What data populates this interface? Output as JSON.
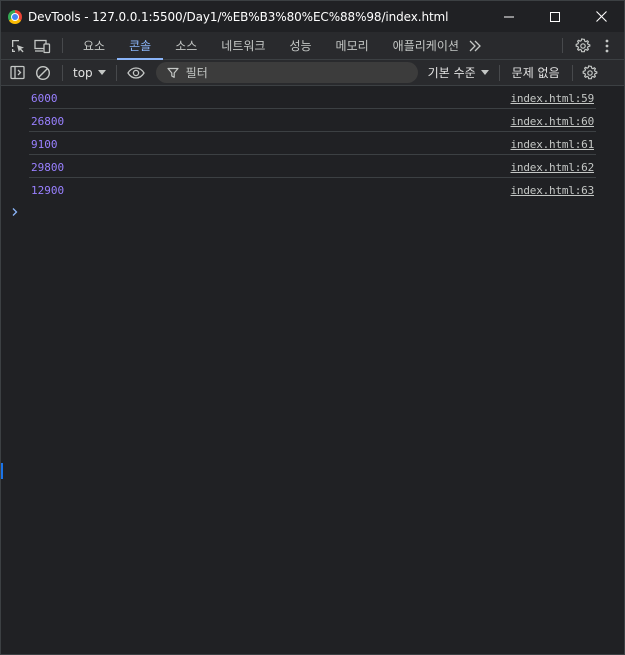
{
  "window": {
    "title": "DevTools - 127.0.0.1:5500/Day1/%EB%B3%80%EC%88%98/index.html"
  },
  "tabs": [
    {
      "label": "요소",
      "active": false
    },
    {
      "label": "콘솔",
      "active": true
    },
    {
      "label": "소스",
      "active": false
    },
    {
      "label": "네트워크",
      "active": false
    },
    {
      "label": "성능",
      "active": false
    },
    {
      "label": "메모리",
      "active": false
    },
    {
      "label": "애플리케이션",
      "active": false
    }
  ],
  "toolbar": {
    "context": "top",
    "filter_placeholder": "필터",
    "levels_label": "기본 수준",
    "issues_label": "문제 없음"
  },
  "console": {
    "messages": [
      {
        "value": "6000",
        "source": "index.html:59"
      },
      {
        "value": "26800",
        "source": "index.html:60"
      },
      {
        "value": "9100",
        "source": "index.html:61"
      },
      {
        "value": "29800",
        "source": "index.html:62"
      },
      {
        "value": "12900",
        "source": "index.html:63"
      }
    ]
  },
  "colors": {
    "accent": "#8ab4f8",
    "number": "#9980ff",
    "background": "#202124"
  }
}
